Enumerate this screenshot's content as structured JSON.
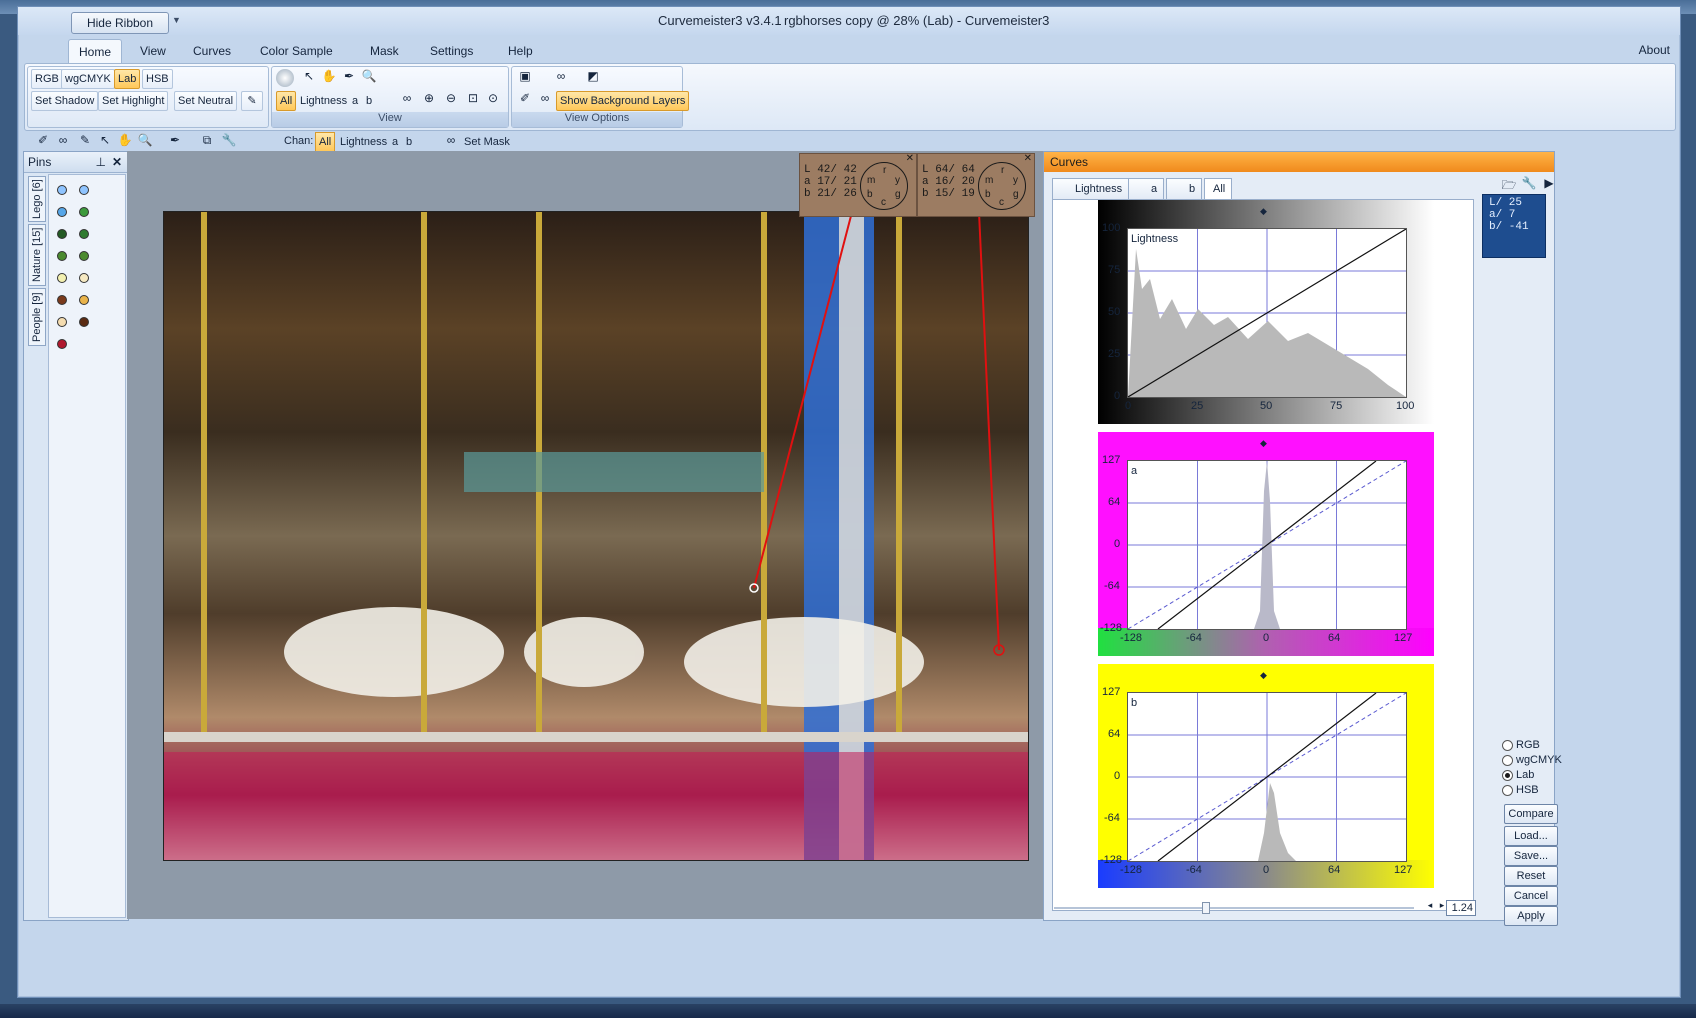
{
  "window": {
    "hide_ribbon": "Hide Ribbon",
    "app_title": "Curvemeister3 v3.4.1",
    "doc_title": "rgbhorses copy @ 28% (Lab) - Curvemeister3",
    "about": "About"
  },
  "menu": [
    "Home",
    "View",
    "Curves",
    "Color Sample",
    "Mask",
    "Settings",
    "Help"
  ],
  "ribbon": {
    "modes": [
      "RGB",
      "wgCMYK",
      "Lab",
      "HSB"
    ],
    "set_buttons": [
      "Set Shadow",
      "Set Highlight",
      "Set Neutral"
    ],
    "channels": [
      "All",
      "Lightness",
      "a",
      "b"
    ],
    "view_label": "View",
    "show_bg_layers": "Show Background Layers",
    "view_options_label": "View Options"
  },
  "toolbar": {
    "chan_label": "Chan:",
    "channels": [
      "All",
      "Lightness",
      "a",
      "b"
    ],
    "set_mask": "Set Mask"
  },
  "pins": {
    "title": "Pins",
    "tabs": [
      "Lego [6]",
      "Nature [15]",
      "People [9]"
    ]
  },
  "samples": [
    {
      "L": "42/ 42",
      "a": "17/ 21",
      "b": "21/ 26"
    },
    {
      "L": "64/ 64",
      "a": "16/ 20",
      "b": "15/ 19"
    }
  ],
  "curves": {
    "title": "Curves",
    "tabs": [
      "Lightness",
      "a",
      "b",
      "All"
    ],
    "lightness": {
      "label": "Lightness",
      "y_ticks": [
        "100",
        "75",
        "50",
        "25",
        "0"
      ],
      "x_ticks": [
        "0",
        "25",
        "50",
        "75",
        "100"
      ]
    },
    "a": {
      "label": "a",
      "y_ticks": [
        "127",
        "64",
        "0",
        "-64",
        "-128"
      ],
      "x_ticks": [
        "-128",
        "-64",
        "0",
        "64",
        "127"
      ]
    },
    "b": {
      "label": "b",
      "y_ticks": [
        "127",
        "64",
        "0",
        "-64",
        "-128"
      ],
      "x_ticks": [
        "-128",
        "-64",
        "0",
        "64",
        "127"
      ]
    },
    "readout": {
      "L": "L/  25",
      "a": "a/   7",
      "b": "b/ -41"
    },
    "color_modes": [
      "RGB",
      "wgCMYK",
      "Lab",
      "HSB"
    ],
    "selected_mode": "Lab",
    "buttons": [
      "Compare",
      "Load...",
      "Save...",
      "Reset",
      "Cancel",
      "Apply"
    ],
    "gamma": "1.24"
  }
}
